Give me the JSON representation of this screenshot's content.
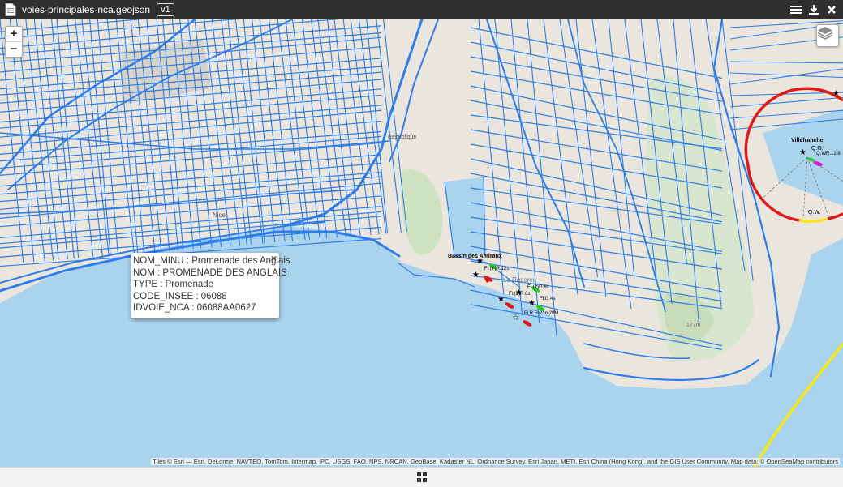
{
  "titlebar": {
    "filename": "voies-principales-nca.geojson",
    "version": "v1",
    "menu_icon": "hamburger-icon",
    "download_icon": "download-icon",
    "close_icon": "close-icon"
  },
  "zoom": {
    "in": "+",
    "out": "−"
  },
  "popup": {
    "rows": [
      "NOM_MINU : Promenade des Anglais",
      "NOM : PROMENADE DES ANGLAIS",
      "TYPE : Promenade",
      "CODE_INSEE : 06088",
      "IDVOIE_NCA : 06088AA0627"
    ],
    "close": "×"
  },
  "map_labels": {
    "bassin": "Bassin des Amiraux",
    "villefranche": "Villefranche",
    "qg": "Q.G.",
    "qwr": "Q.WR.12/8",
    "qw": "Q.W.",
    "fly": "Fl.(Y)R.12s",
    "fl2": "Fl.(2)G.6s",
    "fl2r": "Fl.(2)R.6s",
    "flg": "Fl.G.4s",
    "flr5": "Fl.R.5s21m20M",
    "reserve": "La Réserve",
    "alt": "177m",
    "nice": "Nice",
    "republique": "République"
  },
  "attribution": "Tiles © Esri — Esri, DeLorme, NAVTEQ, TomTom, Intermap, iPC, USGS, FAO, NPS, NRCAN, GeoBase, Kadaster NL, Ordnance Survey, Esri Japan, METI, Esri China (Hong Kong), and the GIS User Community, Map data: © OpenSeaMap contributors",
  "colors": {
    "road": "#2e7de9",
    "sea": "#aad3ee",
    "land": "#eae6de",
    "titlebar": "#2f2f2f"
  },
  "bottombar": {
    "icon": "grid-icon"
  }
}
